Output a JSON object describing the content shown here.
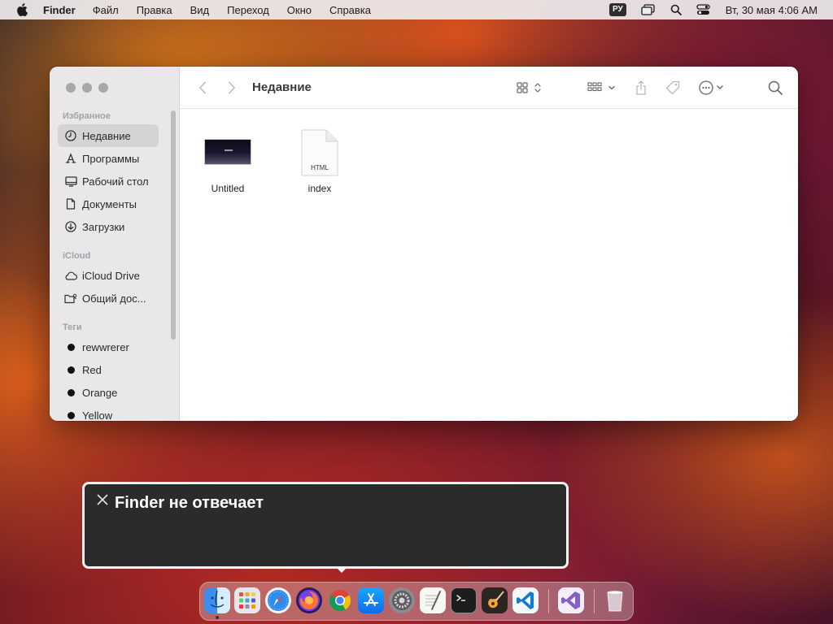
{
  "menubar": {
    "app_name": "Finder",
    "items": [
      "Файл",
      "Правка",
      "Вид",
      "Переход",
      "Окно",
      "Справка"
    ],
    "language": "РУ",
    "clock": "Вт, 30 мая  4:06 AM"
  },
  "finder": {
    "title": "Недавние",
    "sidebar": {
      "favorites_title": "Избранное",
      "favorites": [
        {
          "label": "Недавние",
          "icon": "clock-icon",
          "selected": true
        },
        {
          "label": "Программы",
          "icon": "apps-icon"
        },
        {
          "label": "Рабочий стол",
          "icon": "desktop-icon"
        },
        {
          "label": "Документы",
          "icon": "document-icon"
        },
        {
          "label": "Загрузки",
          "icon": "download-icon"
        }
      ],
      "icloud_title": "iCloud",
      "icloud": [
        {
          "label": "iCloud Drive",
          "icon": "cloud-icon"
        },
        {
          "label": "Общий дос...",
          "icon": "shared-folder-icon"
        }
      ],
      "tags_title": "Теги",
      "tags": [
        {
          "label": "rewwrerer"
        },
        {
          "label": "Red"
        },
        {
          "label": "Orange"
        },
        {
          "label": "Yellow"
        }
      ]
    },
    "files": [
      {
        "name": "Untitled",
        "icon": "image-thumbnail-icon"
      },
      {
        "name": "index",
        "icon": "html-file-icon",
        "badge": "HTML"
      }
    ]
  },
  "notification": {
    "message": "Finder не отвечает"
  },
  "dock": {
    "apps": [
      "Finder",
      "Launchpad",
      "Safari",
      "Firefox",
      "Chrome",
      "App Store",
      "System Settings",
      "TextEdit",
      "Terminal",
      "GarageBand",
      "Visual Studio Code",
      "Visual Studio",
      "Trash"
    ]
  },
  "colors": {
    "selection": "#d5d3d6",
    "notification_bg": "#2b2b2b"
  }
}
